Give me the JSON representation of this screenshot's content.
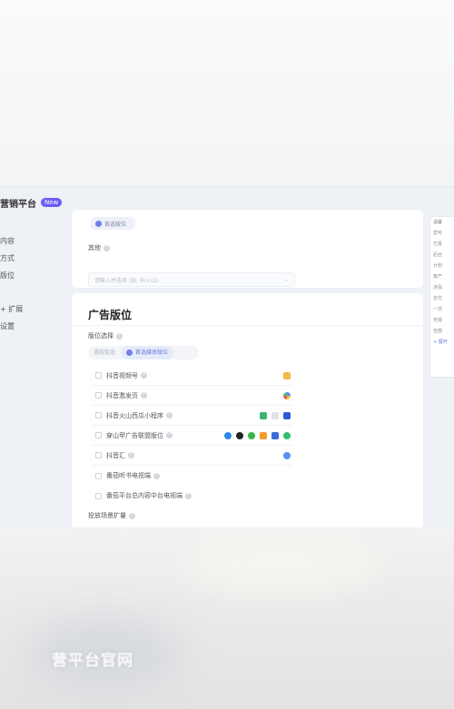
{
  "header": {
    "brand": "营销平台",
    "badge": "New"
  },
  "sidebar": {
    "items": [
      "内容",
      "方式",
      "版位",
      "+ 扩展",
      "设置"
    ]
  },
  "targeting_card": {
    "chip": "首选版位",
    "label": "其他",
    "select_placeholder": "请输入并选择 (如: 抖火山)"
  },
  "placement_card": {
    "title": "广告版位",
    "subtitle": "版位选择",
    "tabs": [
      "通投智选",
      "首选媒体版位"
    ],
    "rows": [
      {
        "label": "抖音视频号"
      },
      {
        "label": "抖音激发页"
      },
      {
        "label": "抖音火山西瓜小程序"
      },
      {
        "label": "穿山甲广告联盟版位"
      },
      {
        "label": "抖音汇"
      },
      {
        "label": "番茄听书电视端"
      },
      {
        "label": "番茄平台总内容中台电视端"
      }
    ],
    "extra_label": "投放场景扩量"
  },
  "right_panel": {
    "lines": [
      "温馨",
      "您可",
      "已投",
      "后台",
      "计划",
      "复产",
      "涉及",
      "支付",
      "一次",
      "无效",
      "全部",
      "+ 展开"
    ]
  },
  "overlay": {
    "caption": "营平台官网"
  },
  "colors": {
    "accent": "#6a5cf6",
    "tab_active": "#6878d8"
  }
}
